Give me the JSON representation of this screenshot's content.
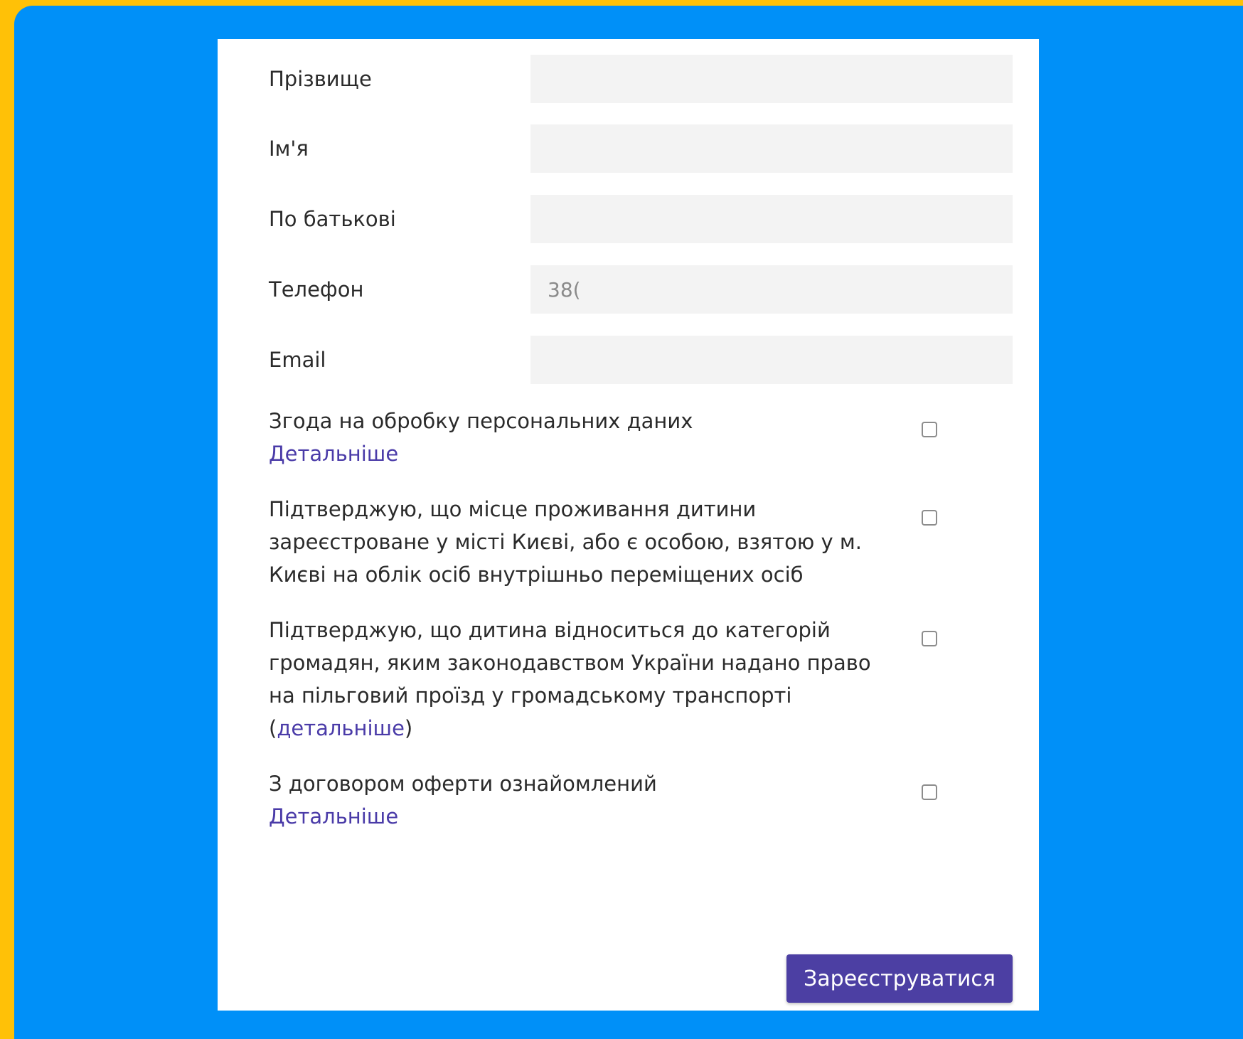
{
  "colors": {
    "frame": "#FFC107",
    "background": "#0090F8",
    "card": "#FFFFFF",
    "input_bg": "#F3F3F3",
    "link": "#4A3BA8",
    "button": "#4C3FA3"
  },
  "fields": {
    "surname": {
      "label": "Прізвище",
      "value": "",
      "placeholder": ""
    },
    "first_name": {
      "label": "Ім'я",
      "value": "",
      "placeholder": ""
    },
    "patronymic": {
      "label": "По батькові",
      "value": "",
      "placeholder": ""
    },
    "phone": {
      "label": "Телефон",
      "value": "",
      "placeholder": "38("
    },
    "email": {
      "label": "Email",
      "value": "",
      "placeholder": ""
    }
  },
  "consents": {
    "personal_data": {
      "text": "Згода на обробку персональних даних",
      "link": "Детальніше",
      "checked": false
    },
    "residence": {
      "text": "Підтверджую, що місце проживання дитини зареєстроване у місті Києві, або є особою, взятою у м. Києві на облік осіб внутрішньо переміщених осіб",
      "checked": false
    },
    "benefit": {
      "text": "Підтверджую, що дитина відноситься до категорій громадян, яким законодавством України надано право на пільговий проїзд у громадському транспорті",
      "open_paren": "(",
      "link": "детальніше",
      "close_paren": ")",
      "checked": false
    },
    "offer": {
      "text": "З договором оферти ознайомлений",
      "link": "Детальніше",
      "checked": false
    }
  },
  "submit": {
    "label": "Зареєструватися"
  }
}
